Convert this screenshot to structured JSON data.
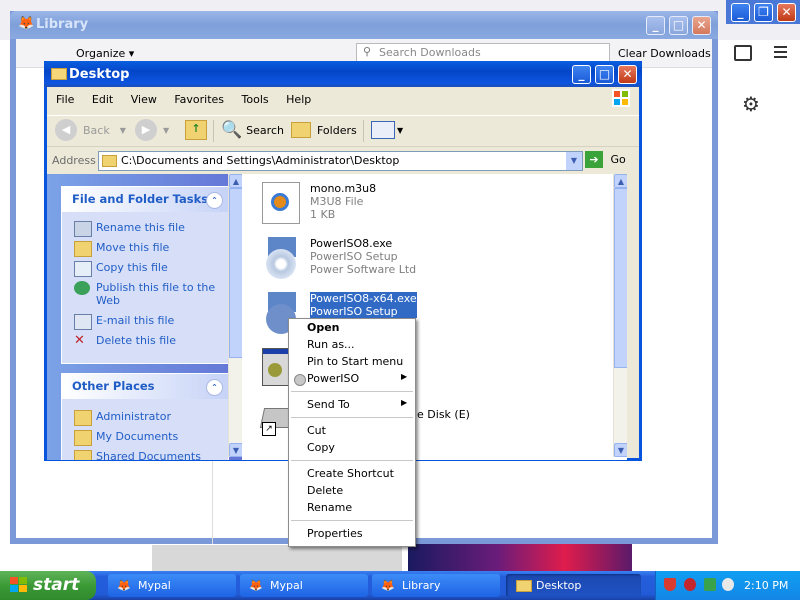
{
  "browser": {
    "window_controls": {
      "minimize": "_",
      "restore": "❐",
      "close": "✕"
    },
    "sidebar_icon": "sidebar-icon",
    "menu_icon": "hamburger-icon"
  },
  "library": {
    "title": "Library",
    "organize_label": "Organize",
    "search_placeholder": "Search Downloads",
    "clear_downloads_label": "Clear Downloads",
    "controls": {
      "minimize": "_",
      "maximize": "□",
      "close": "✕"
    }
  },
  "explorer": {
    "title": "Desktop",
    "controls": {
      "minimize": "_",
      "maximize": "□",
      "close": "✕"
    },
    "menu": [
      "File",
      "Edit",
      "View",
      "Favorites",
      "Tools",
      "Help"
    ],
    "toolbar": {
      "back": "Back",
      "search": "Search",
      "folders": "Folders"
    },
    "address": {
      "label": "Address",
      "value": "C:\\Documents and Settings\\Administrator\\Desktop",
      "go": "Go"
    },
    "tasks": {
      "title": "File and Folder Tasks",
      "items": [
        "Rename this file",
        "Move this file",
        "Copy this file",
        "Publish this file to the Web",
        "E-mail this file",
        "Delete this file"
      ]
    },
    "places": {
      "title": "Other Places",
      "items": [
        "Administrator",
        "My Documents",
        "Shared Documents"
      ]
    },
    "files": [
      {
        "name": "mono.m3u8",
        "type": "M3U8 File",
        "detail": "1 KB"
      },
      {
        "name": "PowerISO8.exe",
        "type": "PowerISO Setup",
        "detail": "Power Software Ltd"
      },
      {
        "name": "PowerISO8-x64.exe",
        "type": "PowerISO Setup",
        "detail": ""
      },
      {
        "name": "",
        "type": "",
        "detail": ""
      },
      {
        "name": "ble Disk (E)",
        "type": "",
        "detail": ""
      }
    ]
  },
  "context_menu": {
    "items": [
      "Open",
      "Run as...",
      "Pin to Start menu",
      "PowerISO",
      "Send To",
      "Cut",
      "Copy",
      "Create Shortcut",
      "Delete",
      "Rename",
      "Properties"
    ]
  },
  "taskbar": {
    "start": "start",
    "buttons": [
      "Mypal",
      "Mypal",
      "Library",
      "Desktop"
    ],
    "clock": "2:10 PM"
  },
  "colors": {
    "xp_blue": "#0855dd",
    "task_link": "#215dc6",
    "start_green": "#3c9a36",
    "highlight": "#316ac5"
  }
}
